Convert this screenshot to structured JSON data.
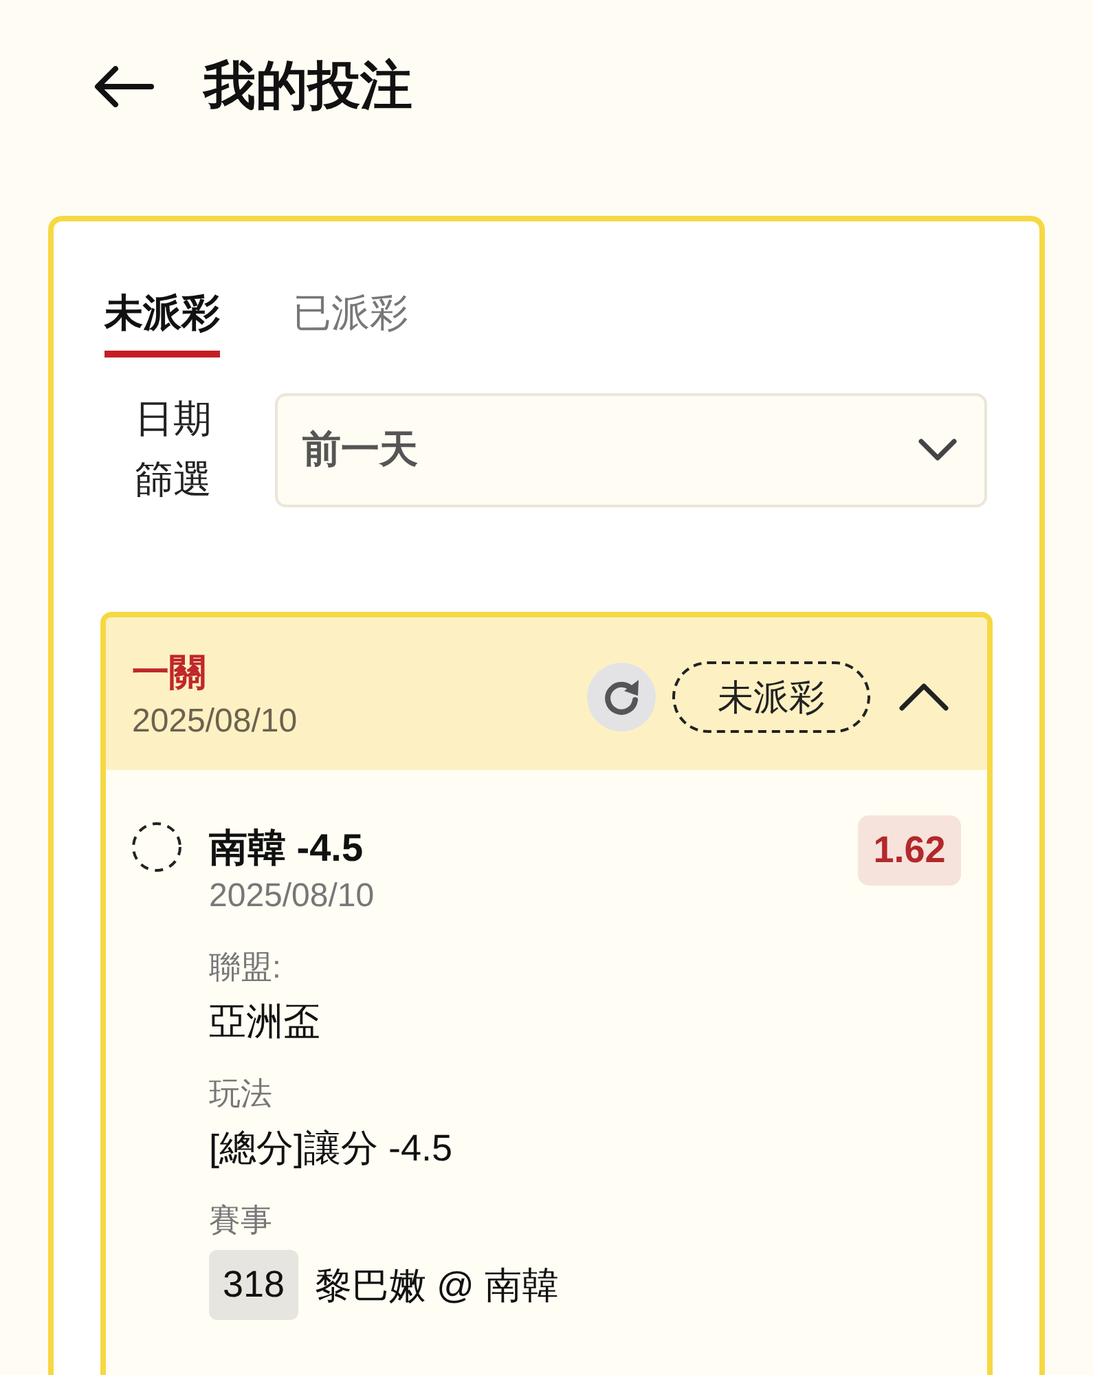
{
  "header": {
    "title": "我的投注"
  },
  "tabs": [
    {
      "label": "未派彩",
      "selected": true
    },
    {
      "label": "已派彩",
      "selected": false
    }
  ],
  "date_filter": {
    "label": "日期篩選",
    "value": "前一天"
  },
  "bets": [
    {
      "type": "一關",
      "date": "2025/08/10",
      "status": "未派彩",
      "expanded": true,
      "selections": [
        {
          "name": "南韓 -4.5",
          "odds": "1.62",
          "date": "2025/08/10",
          "fields": [
            {
              "kind": "text",
              "label": "聯盟:",
              "value": "亞洲盃"
            },
            {
              "kind": "text",
              "label": "玩法",
              "value": "[總分]讓分 -4.5"
            },
            {
              "kind": "match",
              "label": "賽事",
              "number": "318",
              "value": "黎巴嫩 @ 南韓"
            }
          ]
        }
      ]
    }
  ]
}
